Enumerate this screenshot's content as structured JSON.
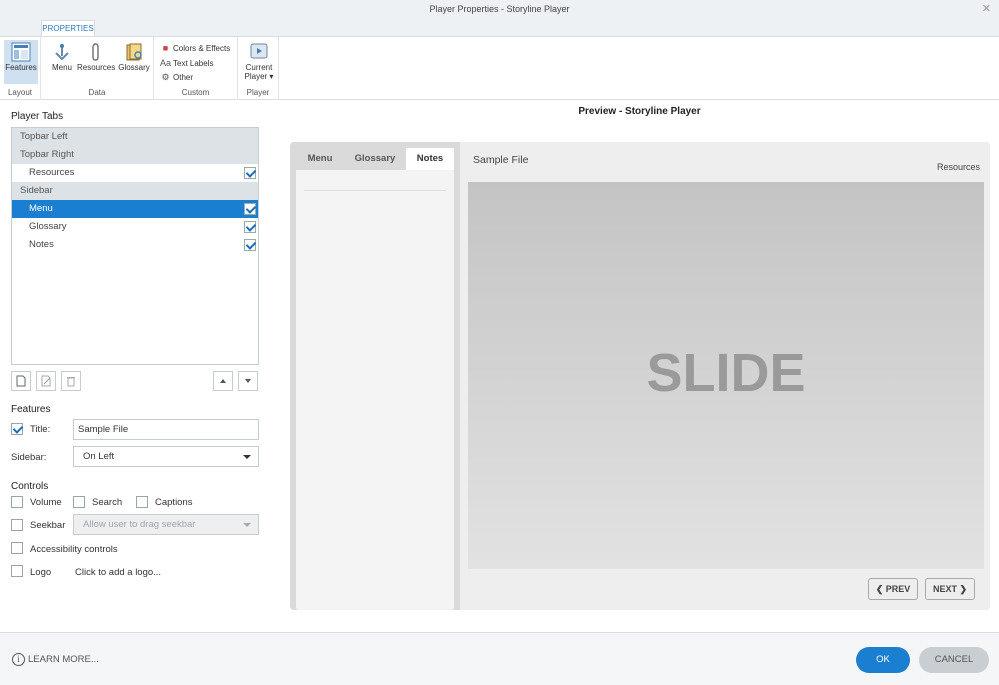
{
  "window": {
    "title": "Player Properties - Storyline Player",
    "close_glyph": "✕"
  },
  "ribbon": {
    "tab_label": "PROPERTIES",
    "groups": {
      "layout": {
        "label": "Layout",
        "features_label": "Features"
      },
      "data": {
        "label": "Data",
        "menu_label": "Menu",
        "resources_label": "Resources",
        "glossary_label": "Glossary"
      },
      "custom": {
        "label": "Custom",
        "colors_label": "Colors & Effects",
        "text_labels_label": "Text Labels",
        "other_label": "Other"
      },
      "player": {
        "label": "Player",
        "current_line1": "Current",
        "current_line2": "Player ▾"
      }
    }
  },
  "player_tabs": {
    "heading": "Player Tabs",
    "groups": [
      {
        "label": "Topbar Left"
      },
      {
        "label": "Topbar Right"
      },
      {
        "label": "Sidebar"
      }
    ],
    "items": [
      {
        "label": "Resources",
        "checked": true
      },
      {
        "label": "Menu",
        "checked": true,
        "selected": true
      },
      {
        "label": "Glossary",
        "checked": true
      },
      {
        "label": "Notes",
        "checked": true
      }
    ]
  },
  "features": {
    "heading": "Features",
    "title_label": "Title:",
    "title_checked": true,
    "title_value": "Sample File",
    "sidebar_label": "Sidebar:",
    "sidebar_value": "On Left"
  },
  "controls": {
    "heading": "Controls",
    "volume": "Volume",
    "search": "Search",
    "captions": "Captions",
    "seekbar": "Seekbar",
    "seekbar_option": "Allow user to drag seekbar",
    "accessibility": "Accessibility controls",
    "logo": "Logo",
    "logo_hint": "Click to add a logo..."
  },
  "preview": {
    "heading": "Preview - Storyline Player",
    "tabs": [
      "Menu",
      "Glossary",
      "Notes"
    ],
    "active_tab": "Notes",
    "sample_title": "Sample File",
    "resources_link": "Resources",
    "slide_text": "SLIDE",
    "prev_label": "❮ PREV",
    "next_label": "NEXT ❯"
  },
  "footer": {
    "learn_more": "LEARN MORE...",
    "ok_label": "OK",
    "cancel_label": "CANCEL"
  },
  "colors": {
    "accent": "#1a7fd0",
    "selected_row": "#1a7fd0",
    "cancel_bg": "#c9ced3"
  }
}
